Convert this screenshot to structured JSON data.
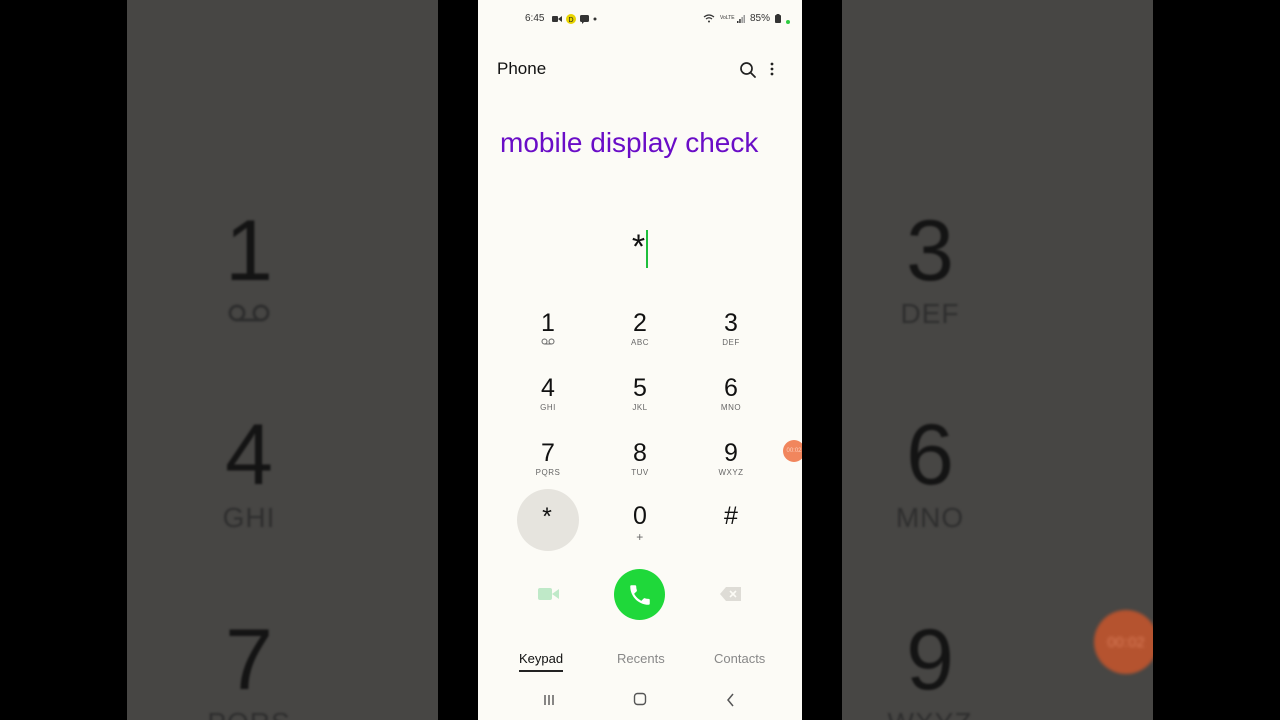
{
  "status_bar": {
    "time": "6:45",
    "battery": "85%",
    "volte": "VoLTE"
  },
  "appbar": {
    "title": "Phone"
  },
  "overlay_caption": "mobile display check",
  "dialed_number": "*",
  "keypad": [
    {
      "digit": "1",
      "letters": "voicemail-icon"
    },
    {
      "digit": "2",
      "letters": "ABC"
    },
    {
      "digit": "3",
      "letters": "DEF"
    },
    {
      "digit": "4",
      "letters": "GHI"
    },
    {
      "digit": "5",
      "letters": "JKL"
    },
    {
      "digit": "6",
      "letters": "MNO"
    },
    {
      "digit": "7",
      "letters": "PQRS"
    },
    {
      "digit": "8",
      "letters": "TUV"
    },
    {
      "digit": "9",
      "letters": "WXYZ"
    },
    {
      "digit": "*",
      "letters": ""
    },
    {
      "digit": "0",
      "letters": "+"
    },
    {
      "digit": "#",
      "letters": ""
    }
  ],
  "recording_timer": "00:02",
  "tabs": [
    {
      "label": "Keypad",
      "active": true
    },
    {
      "label": "Recents",
      "active": false
    },
    {
      "label": "Contacts",
      "active": false
    }
  ],
  "background_zoom": {
    "left_keys": [
      {
        "digit": "1",
        "letters": "voicemail-icon"
      },
      {
        "digit": "4",
        "letters": "GHI"
      },
      {
        "digit": "7",
        "letters": "PQRS"
      }
    ],
    "right_keys": [
      {
        "digit": "3",
        "letters": "DEF"
      },
      {
        "digit": "6",
        "letters": "MNO"
      },
      {
        "digit": "9",
        "letters": "WXYZ"
      }
    ]
  },
  "colors": {
    "accent_call": "#1fd83a",
    "caption": "#6a0dc7",
    "cursor": "#1fbf3c",
    "record_bubble": "#f1865d"
  }
}
